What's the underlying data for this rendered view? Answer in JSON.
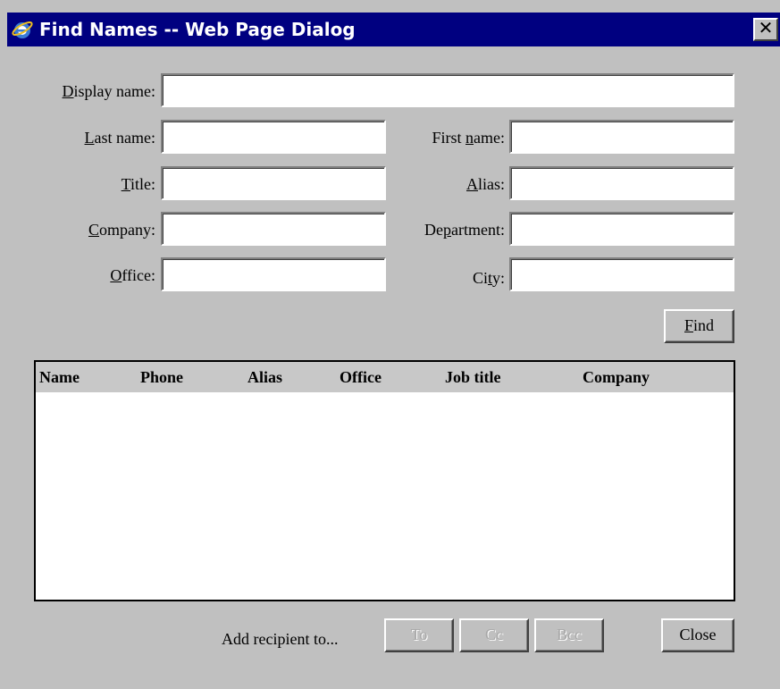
{
  "window": {
    "title": "Find Names -- Web Page Dialog",
    "close_glyph": "✕"
  },
  "form": {
    "display_name": {
      "label_underlined": "D",
      "label_rest": "isplay name:",
      "value": ""
    },
    "last_name": {
      "label_underlined": "L",
      "label_rest": "ast name:",
      "value": ""
    },
    "first_name": {
      "label_pre": "First ",
      "label_underlined": "n",
      "label_rest": "ame:",
      "value": ""
    },
    "title": {
      "label_underlined": "T",
      "label_rest": "itle:",
      "value": ""
    },
    "alias": {
      "label_underlined": "A",
      "label_rest": "lias:",
      "value": ""
    },
    "company": {
      "label_underlined": "C",
      "label_rest": "ompany:",
      "value": ""
    },
    "department": {
      "label_pre": "De",
      "label_underlined": "p",
      "label_rest": "artment:",
      "value": ""
    },
    "office": {
      "label_underlined": "O",
      "label_rest": "ffice:",
      "value": ""
    },
    "city": {
      "label_pre": "Ci",
      "label_underlined": "t",
      "label_rest": "y:",
      "value": ""
    },
    "find_underlined": "F",
    "find_rest": "ind"
  },
  "results": {
    "columns": [
      "Name",
      "Phone",
      "Alias",
      "Office",
      "Job title",
      "Company"
    ],
    "rows": []
  },
  "footer": {
    "add_recipient_label": "Add recipient to...",
    "to_label": "To",
    "cc_label": "Cc",
    "bcc_label": "Bcc",
    "close_label": "Close"
  },
  "colors": {
    "titlebar": "#000080",
    "dialog_background": "#c0c0c0"
  }
}
